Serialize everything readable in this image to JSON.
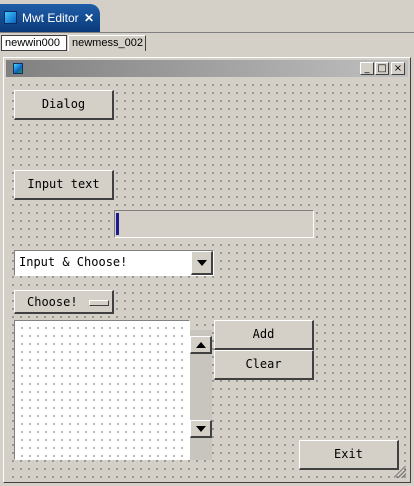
{
  "editor_tab": {
    "title": "Mwt Editor",
    "close_glyph": "✕",
    "icon": "mwt-editor-icon"
  },
  "subtabs": [
    {
      "label": "newwin000",
      "active": true
    },
    {
      "label": "newmess_002",
      "active": false
    }
  ],
  "design_window": {
    "icon": "window-app-icon",
    "minimize_glyph": "_",
    "maximize_glyph": "□",
    "close_glyph": "×"
  },
  "widgets": {
    "dialog_button": "Dialog",
    "input_text_button": "Input text",
    "text_field_value": "",
    "combo_value": "Input & Choose!",
    "choose_button": "Choose!",
    "add_button": "Add",
    "clear_button": "Clear",
    "exit_button": "Exit"
  },
  "colors": {
    "tab_active": "#1f5fa8",
    "window_bg": "#d4d0c8",
    "caret": "#1c1c8c"
  }
}
